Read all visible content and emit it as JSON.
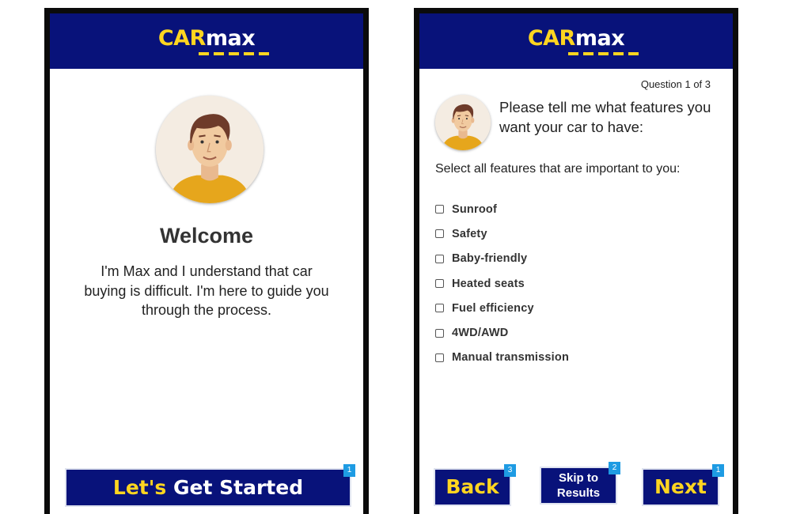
{
  "brand": {
    "logo_car": "CAR",
    "logo_max": "max",
    "logo_yellow": "#ffd520",
    "header_color": "#08127a"
  },
  "welcome_screen": {
    "title": "Welcome",
    "intro_text": "I'm Max and I understand that car buying is difficult. I'm here to guide you through the process.",
    "cta_part1": "Let's",
    "cta_part2": "Get Started",
    "cta_badge": "1"
  },
  "question_screen": {
    "counter": "Question 1 of 3",
    "question": "Please tell me what features you want your car to have:",
    "instruction": "Select all features that are important to you:",
    "options": [
      {
        "label": "Sunroof",
        "checked": false
      },
      {
        "label": "Safety",
        "checked": false
      },
      {
        "label": "Baby-friendly",
        "checked": false
      },
      {
        "label": "Heated seats",
        "checked": false
      },
      {
        "label": "Fuel efficiency",
        "checked": false
      },
      {
        "label": "4WD/AWD",
        "checked": false
      },
      {
        "label": "Manual transmission",
        "checked": false
      }
    ],
    "back_label": "Back",
    "back_badge": "3",
    "skip_line1": "Skip to",
    "skip_line2": "Results",
    "skip_badge": "2",
    "next_label": "Next",
    "next_badge": "1"
  },
  "icons": {
    "avatar": "max-avatar-icon",
    "checkbox": "checkbox-icon"
  }
}
